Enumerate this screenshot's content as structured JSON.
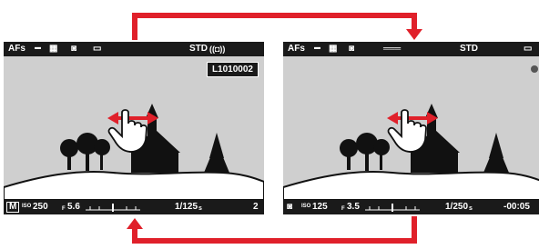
{
  "left_screen": {
    "top_bar": {
      "af_mode": "AFs",
      "image_style": "STD"
    },
    "file_number": "L1010002",
    "bottom_bar": {
      "mode": "M",
      "iso_label": "ISO",
      "iso_value": "250",
      "aperture_prefix": "F",
      "aperture_value": "5.6",
      "shutter": "1/125",
      "shutter_unit": "s",
      "count": "2"
    }
  },
  "right_screen": {
    "top_bar": {
      "af_mode": "AFs",
      "image_style": "STD"
    },
    "bottom_bar": {
      "iso_label": "ISO",
      "iso_value": "125",
      "aperture_prefix": "F",
      "aperture_value": "3.5",
      "shutter": "1/250",
      "shutter_unit": "s",
      "duration": "-00:05"
    }
  },
  "icons": [
    "awb-icon",
    "metering-icon",
    "drive-mode-icon",
    "stabilization-icon",
    "battery-icon",
    "record-dot-icon",
    "video-mode-icon",
    "swipe-gesture-icon",
    "cycle-arrow-icon"
  ],
  "colors": {
    "arrow": "#e0202a",
    "screen_bg": "#cfcfcf",
    "bar_bg": "#1a1a1a"
  }
}
